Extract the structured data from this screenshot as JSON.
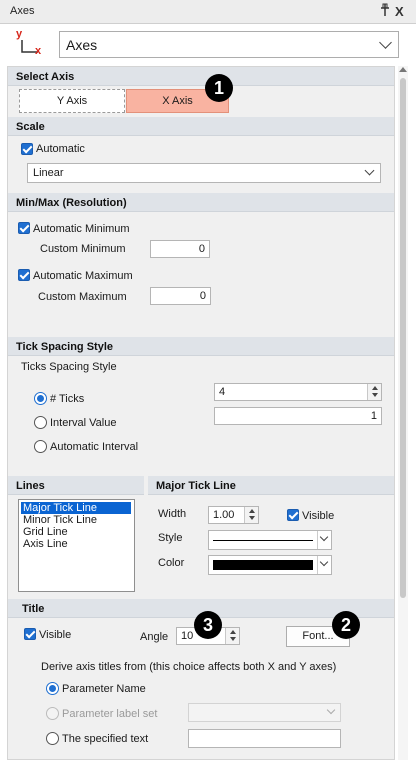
{
  "window": {
    "title": "Axes",
    "pin_glyph": "↕",
    "close_glyph": "X"
  },
  "header": {
    "icon_y": "y",
    "icon_x": "x",
    "selected": "Axes"
  },
  "select_axis": {
    "title": "Select Axis",
    "y_label": "Y Axis",
    "x_label": "X Axis",
    "active": "X Axis",
    "active_color": "#f9b3a1"
  },
  "scale": {
    "title": "Scale",
    "automatic_label": "Automatic",
    "automatic": true,
    "type": "Linear"
  },
  "minmax": {
    "title": "Min/Max (Resolution)",
    "auto_min_label": "Automatic Minimum",
    "auto_min": true,
    "custom_min_label": "Custom Minimum",
    "custom_min": "0",
    "auto_max_label": "Automatic Maximum",
    "auto_max": true,
    "custom_max_label": "Custom Maximum",
    "custom_max": "0"
  },
  "ticks": {
    "title": "Tick Spacing Style",
    "subtitle": "Ticks Spacing Style",
    "opt_ticks": "# Ticks",
    "opt_interval": "Interval Value",
    "opt_auto": "Automatic Interval",
    "selected": "# Ticks",
    "ticks_value": "4",
    "interval_value": "1"
  },
  "lines": {
    "title": "Lines",
    "items": [
      "Major Tick Line",
      "Minor Tick Line",
      "Grid Line",
      "Axis Line"
    ],
    "selected_index": 0
  },
  "major_tick": {
    "title": "Major Tick Line",
    "width_label": "Width",
    "width": "1.00",
    "visible_label": "Visible",
    "visible": true,
    "style_label": "Style",
    "color_label": "Color",
    "color": "#000000"
  },
  "title_section": {
    "title": "Title",
    "visible_label": "Visible",
    "visible": true,
    "angle_label": "Angle",
    "angle": "10",
    "font_button": "Font...",
    "derive_text": "Derive axis titles from (this choice affects both X and Y axes)",
    "opt_param_name": "Parameter Name",
    "opt_param_label": "Parameter label set",
    "opt_specified": "The specified text",
    "selected": "Parameter Name"
  },
  "badges": {
    "b1": "1",
    "b2": "2",
    "b3": "3"
  }
}
